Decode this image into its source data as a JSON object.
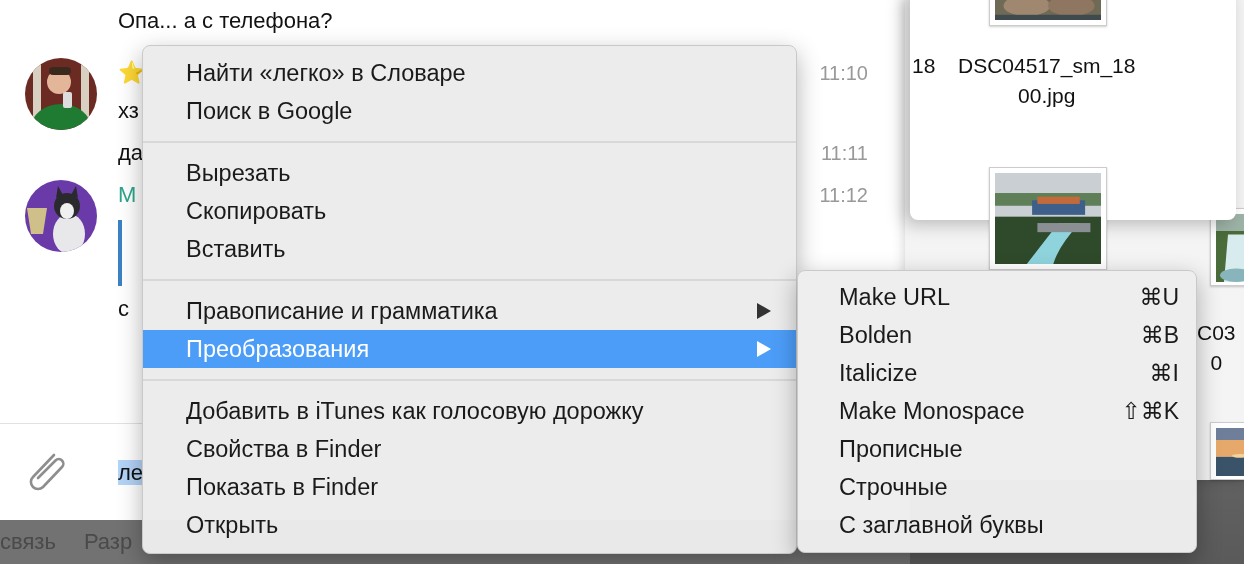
{
  "chat": {
    "messages": [
      {
        "kind": "text",
        "text": "Опа... а с телефона?"
      },
      {
        "kind": "group",
        "lines": [
          {
            "kind": "text",
            "text": "⭐",
            "time": "11:10"
          },
          {
            "kind": "text",
            "text": "хз"
          }
        ]
      },
      {
        "kind": "text",
        "text": "да",
        "time": "11:11"
      },
      {
        "kind": "group",
        "lines": [
          {
            "kind": "author",
            "text": "М",
            "time": "11:12"
          },
          {
            "kind": "quote"
          },
          {
            "kind": "text",
            "text": "с"
          }
        ]
      }
    ]
  },
  "composer": {
    "value": "ле",
    "selected": true
  },
  "desktop_bar": [
    "связь",
    "Разр"
  ],
  "finder_front": {
    "cut_label": "18",
    "file_name": [
      "DSC04517_sm_18",
      "00.jpg"
    ]
  },
  "finder_back": {
    "file_name": [
      "C03",
      "0"
    ]
  },
  "context_menu": {
    "groups": [
      [
        {
          "label": "Найти «легко» в Словаре",
          "submenu": false,
          "selected": false
        },
        {
          "label": "Поиск в Google",
          "submenu": false,
          "selected": false
        }
      ],
      [
        {
          "label": "Вырезать",
          "submenu": false,
          "selected": false
        },
        {
          "label": "Скопировать",
          "submenu": false,
          "selected": false
        },
        {
          "label": "Вставить",
          "submenu": false,
          "selected": false
        }
      ],
      [
        {
          "label": "Правописание и грамматика",
          "submenu": true,
          "selected": false
        },
        {
          "label": "Преобразования",
          "submenu": true,
          "selected": true
        }
      ],
      [
        {
          "label": "Добавить в iTunes как голосовую дорожку",
          "submenu": false,
          "selected": false
        },
        {
          "label": "Свойства в Finder",
          "submenu": false,
          "selected": false
        },
        {
          "label": "Показать в Finder",
          "submenu": false,
          "selected": false
        },
        {
          "label": "Открыть",
          "submenu": false,
          "selected": false
        }
      ]
    ]
  },
  "submenu": {
    "items": [
      {
        "label": "Make URL",
        "shortcut": "⌘U"
      },
      {
        "label": "Bolden",
        "shortcut": "⌘B"
      },
      {
        "label": "Italicize",
        "shortcut": "⌘I"
      },
      {
        "label": "Make Monospace",
        "shortcut": "⇧⌘K"
      },
      {
        "label": "Прописные"
      },
      {
        "label": "Строчные"
      },
      {
        "label": "С заглавной буквы"
      }
    ]
  }
}
